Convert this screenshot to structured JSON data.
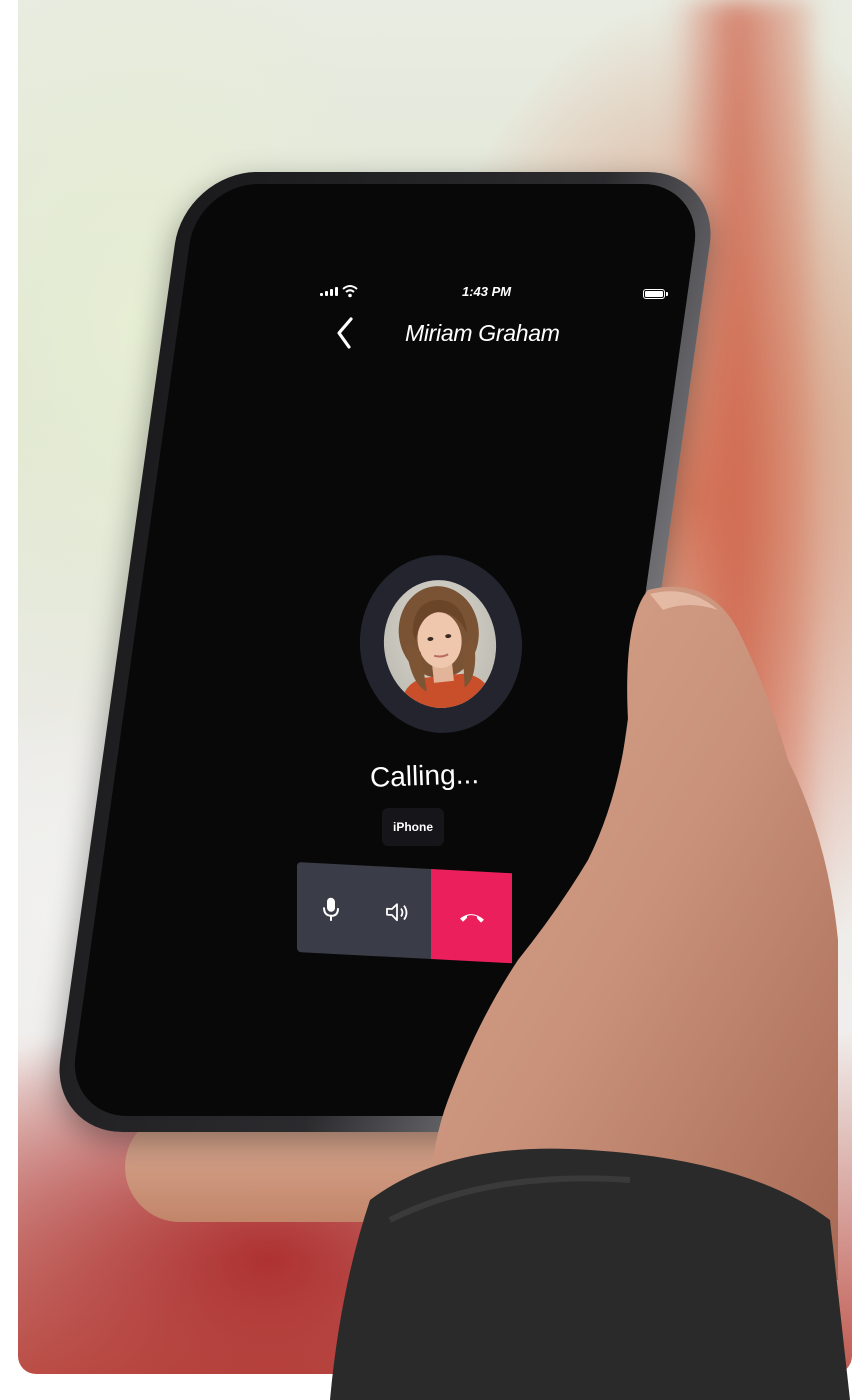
{
  "status_bar": {
    "time": "1:43 PM",
    "signal_icon": "signal-bars-icon",
    "wifi_icon": "wifi-icon",
    "battery_icon": "battery-icon"
  },
  "header": {
    "back_icon": "chevron-left-icon",
    "contact_name": "Miriam Graham"
  },
  "call": {
    "status": "Calling...",
    "device": "iPhone"
  },
  "controls": {
    "mute_icon": "microphone-icon",
    "speaker_icon": "speaker-icon",
    "hangup_icon": "phone-hangup-icon",
    "hangup_color": "#ea1f5b",
    "control_color": "#3a3c48"
  }
}
